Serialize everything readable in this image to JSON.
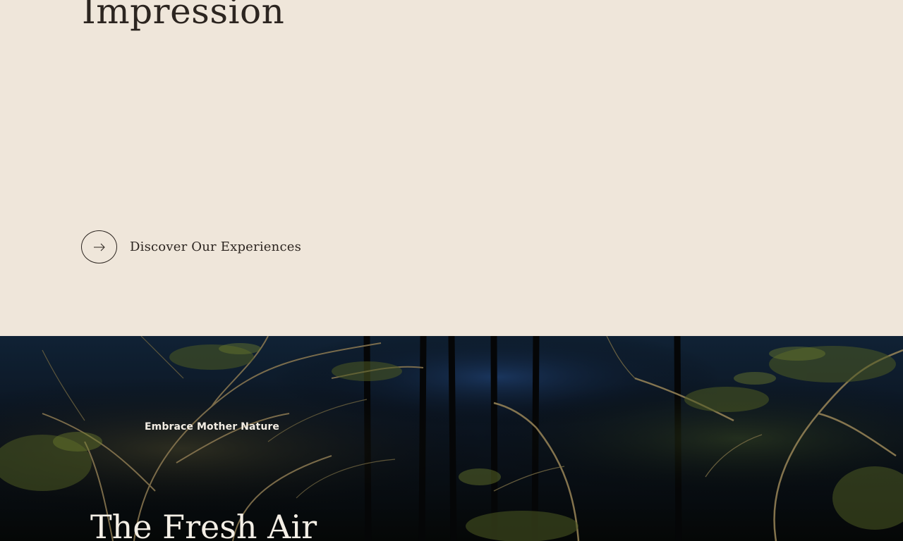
{
  "intro": {
    "title": "Impression",
    "cta_label": "Discover Our Experiences",
    "cta_icon": "arrow-right-icon"
  },
  "hero": {
    "eyebrow": "Embrace Mother Nature",
    "title": "The Fresh Air",
    "image_subject": "forest-at-dusk-photo"
  },
  "colors": {
    "beige_background": "#efe6da",
    "dark_text": "#2c2520",
    "hero_text": "#f4efe6"
  }
}
